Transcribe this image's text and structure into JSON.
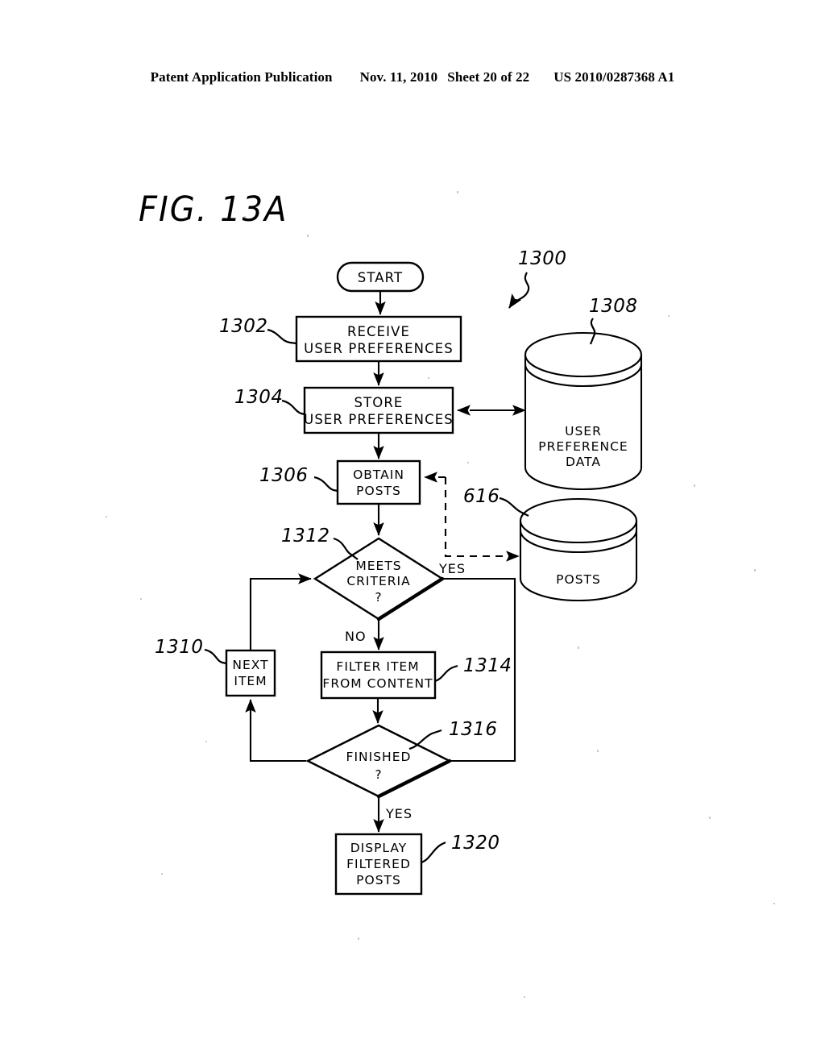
{
  "header": {
    "publication": "Patent Application Publication",
    "date": "Nov. 11, 2010",
    "sheet": "Sheet 20 of 22",
    "patent_number": "US 2010/0287368 A1"
  },
  "figure": {
    "title": "FIG.  13A",
    "diagram_reference": "1300"
  },
  "nodes": {
    "start": {
      "label": "START",
      "shape": "stadium"
    },
    "receive": {
      "line1": "RECEIVE",
      "line2": "USER  PREFERENCES",
      "ref": "1302",
      "shape": "process"
    },
    "store": {
      "line1": "STORE",
      "line2": "USER  PREFERENCES",
      "ref": "1304",
      "shape": "process"
    },
    "obtain": {
      "line1": "OBTAIN",
      "line2": "POSTS",
      "ref": "1306",
      "shape": "process"
    },
    "meets_criteria": {
      "line1": "MEETS",
      "line2": "CRITERIA",
      "line3": "?",
      "ref": "1312",
      "shape": "decision"
    },
    "next_item": {
      "line1": "NEXT",
      "line2": "ITEM",
      "ref": "1310",
      "shape": "process"
    },
    "filter_item": {
      "line1": "FILTER  ITEM",
      "line2": "FROM  CONTENT",
      "ref": "1314",
      "shape": "process"
    },
    "finished": {
      "line1": "FINISHED",
      "line2": "?",
      "ref": "1316",
      "shape": "decision"
    },
    "display": {
      "line1": "DISPLAY",
      "line2": "FILTERED",
      "line3": "POSTS",
      "ref": "1320",
      "shape": "process"
    }
  },
  "datastores": {
    "user_preference_data": {
      "line1": "USER",
      "line2": "PREFERENCE",
      "line3": "DATA",
      "ref": "1308",
      "shape": "cylinder"
    },
    "posts": {
      "line1": "POSTS",
      "ref": "616",
      "shape": "cylinder"
    }
  },
  "edge_labels": {
    "criteria_yes": "YES",
    "criteria_no": "NO",
    "finished_yes": "YES"
  },
  "colors": {
    "ink": "#000000",
    "paper": "#ffffff"
  }
}
